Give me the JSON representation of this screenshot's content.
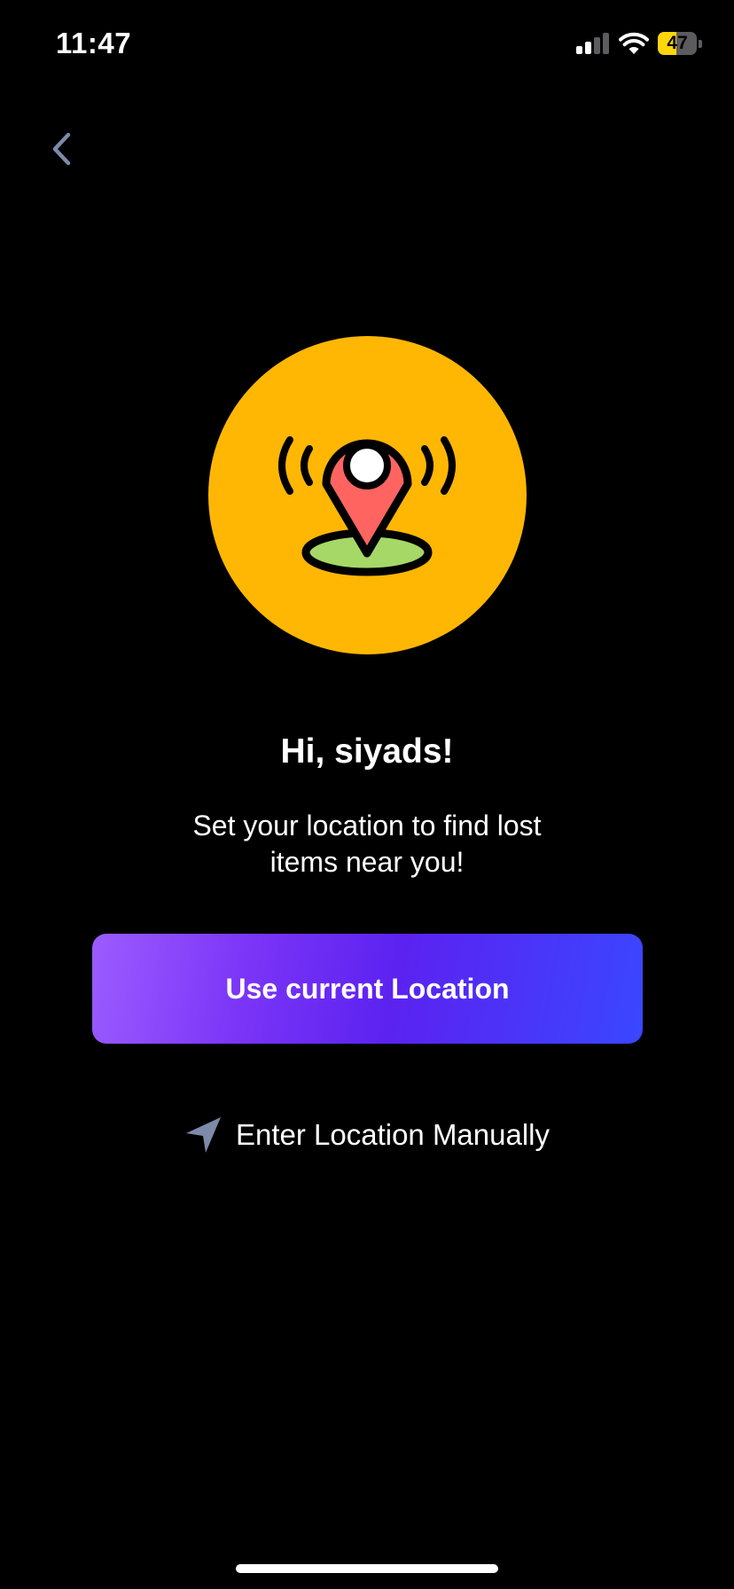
{
  "status_bar": {
    "time": "11:47",
    "battery_percent": "47",
    "battery_level": 0.47,
    "battery_color": "#ffd60a",
    "signal_icon": "cellular-signal-icon",
    "wifi_icon": "wifi-icon",
    "battery_icon": "battery-icon"
  },
  "nav": {
    "back_icon": "chevron-left-icon"
  },
  "hero": {
    "icon": "location-pin-broadcast-icon",
    "circle_color": "#ffb703"
  },
  "main": {
    "greeting": "Hi, siyads!",
    "subtitle": "Set your location to find lost items near you!"
  },
  "actions": {
    "use_current_location_label": "Use current Location",
    "enter_manually_label": "Enter Location Manually",
    "enter_manually_icon": "navigation-arrow-icon"
  },
  "colors": {
    "background": "#000000",
    "button_gradient_start": "#9b5cff",
    "button_gradient_mid": "#5b22f0",
    "button_gradient_end": "#3a47ff",
    "icon_muted": "#7d8aa8"
  }
}
